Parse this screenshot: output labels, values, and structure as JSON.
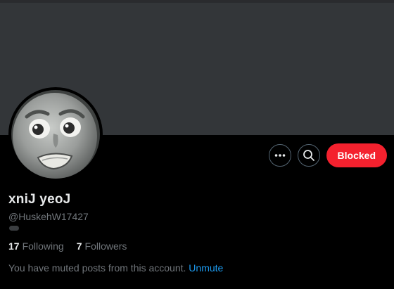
{
  "profile": {
    "display_name": "xniJ yeoJ",
    "handle": "@HuskehW17427",
    "following_count": "17",
    "following_label": "Following",
    "followers_count": "7",
    "followers_label": "Followers"
  },
  "actions": {
    "more_icon": "more-horizontal-icon",
    "search_icon": "search-icon",
    "blocked_label": "Blocked"
  },
  "muted_notice": {
    "text": "You have muted posts from this account.",
    "unmute_label": "Unmute"
  },
  "colors": {
    "background": "#000000",
    "banner": "#333639",
    "blocked_button": "#f4212e",
    "link": "#1d9bf0",
    "secondary_text": "#71767b",
    "primary_text": "#e7e9ea"
  }
}
